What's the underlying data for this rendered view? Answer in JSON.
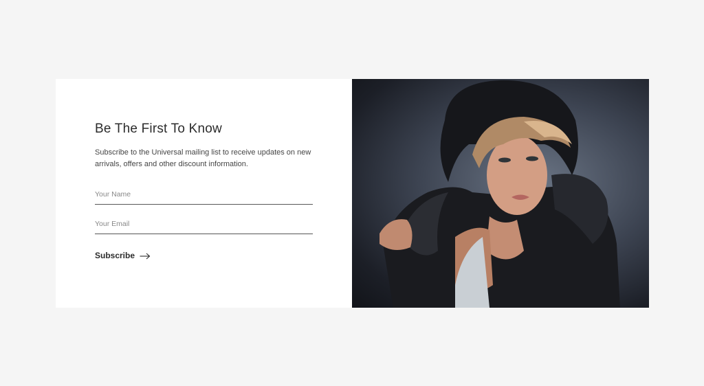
{
  "newsletter": {
    "title": "Be The First To Know",
    "description": "Subscribe to the Universal mailing list to receive updates on new arrivals, offers and other discount information.",
    "name_placeholder": "Your Name",
    "email_placeholder": "Your Email",
    "subscribe_label": "Subscribe",
    "subscribe_icon": "arrow-right-icon"
  },
  "image": {
    "subject": "fashion-model-photo"
  },
  "colors": {
    "page_background": "#f5f5f5",
    "card_background": "#ffffff",
    "text_dark": "#2b2b2b",
    "underline": "#555555"
  }
}
